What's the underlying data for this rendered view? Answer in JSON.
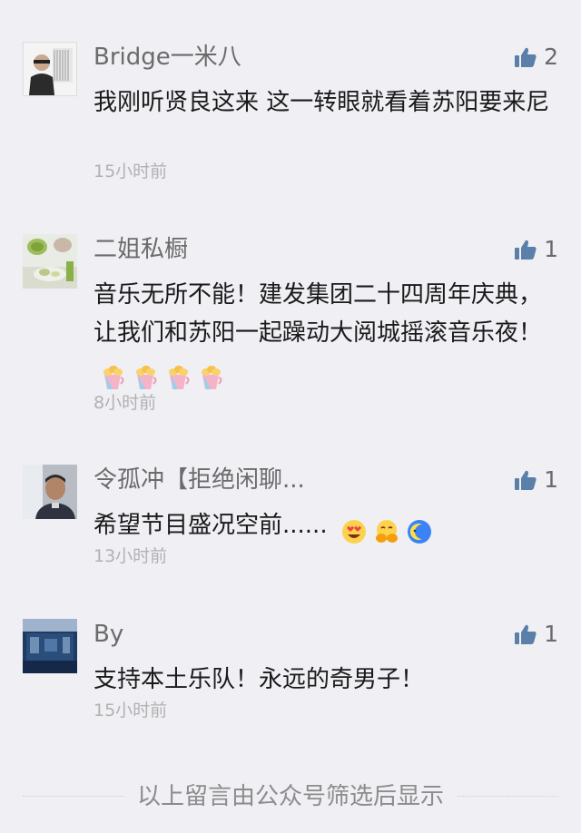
{
  "comments": [
    {
      "name": "Bridge一米八",
      "likes": "2",
      "text": "我刚听贤良这来 这一转眼就看着苏阳要来尼",
      "time": "15小时前",
      "avatar": "avatar-person-piano"
    },
    {
      "name": "二姐私橱",
      "likes": "1",
      "text": "音乐无所不能！建发集团二十四周年庆典，让我们和苏阳一起躁动大阅城摇滚音乐夜！",
      "emojis": [
        "cheers-icon",
        "cheers-icon",
        "cheers-icon",
        "cheers-icon"
      ],
      "time": "8小时前",
      "avatar": "avatar-food-plate"
    },
    {
      "name": "令孤冲【拒绝闲聊...",
      "likes": "1",
      "text": "希望节目盛况空前......",
      "emojis": [
        "heart-eyes-icon",
        "hug-icon",
        "moon-face-icon"
      ],
      "time": "13小时前",
      "avatar": "avatar-man-portrait"
    },
    {
      "name": "By",
      "likes": "1",
      "text": "支持本土乐队！永远的奇男子！",
      "time": "15小时前",
      "avatar": "avatar-blue-room"
    }
  ],
  "footer": {
    "text": "以上留言由公众号筛选后显示"
  },
  "colors": {
    "background": "#efeff4",
    "name": "#6b6b6b",
    "time": "#b2b2b2",
    "like_icon": "#5a7fa8"
  }
}
